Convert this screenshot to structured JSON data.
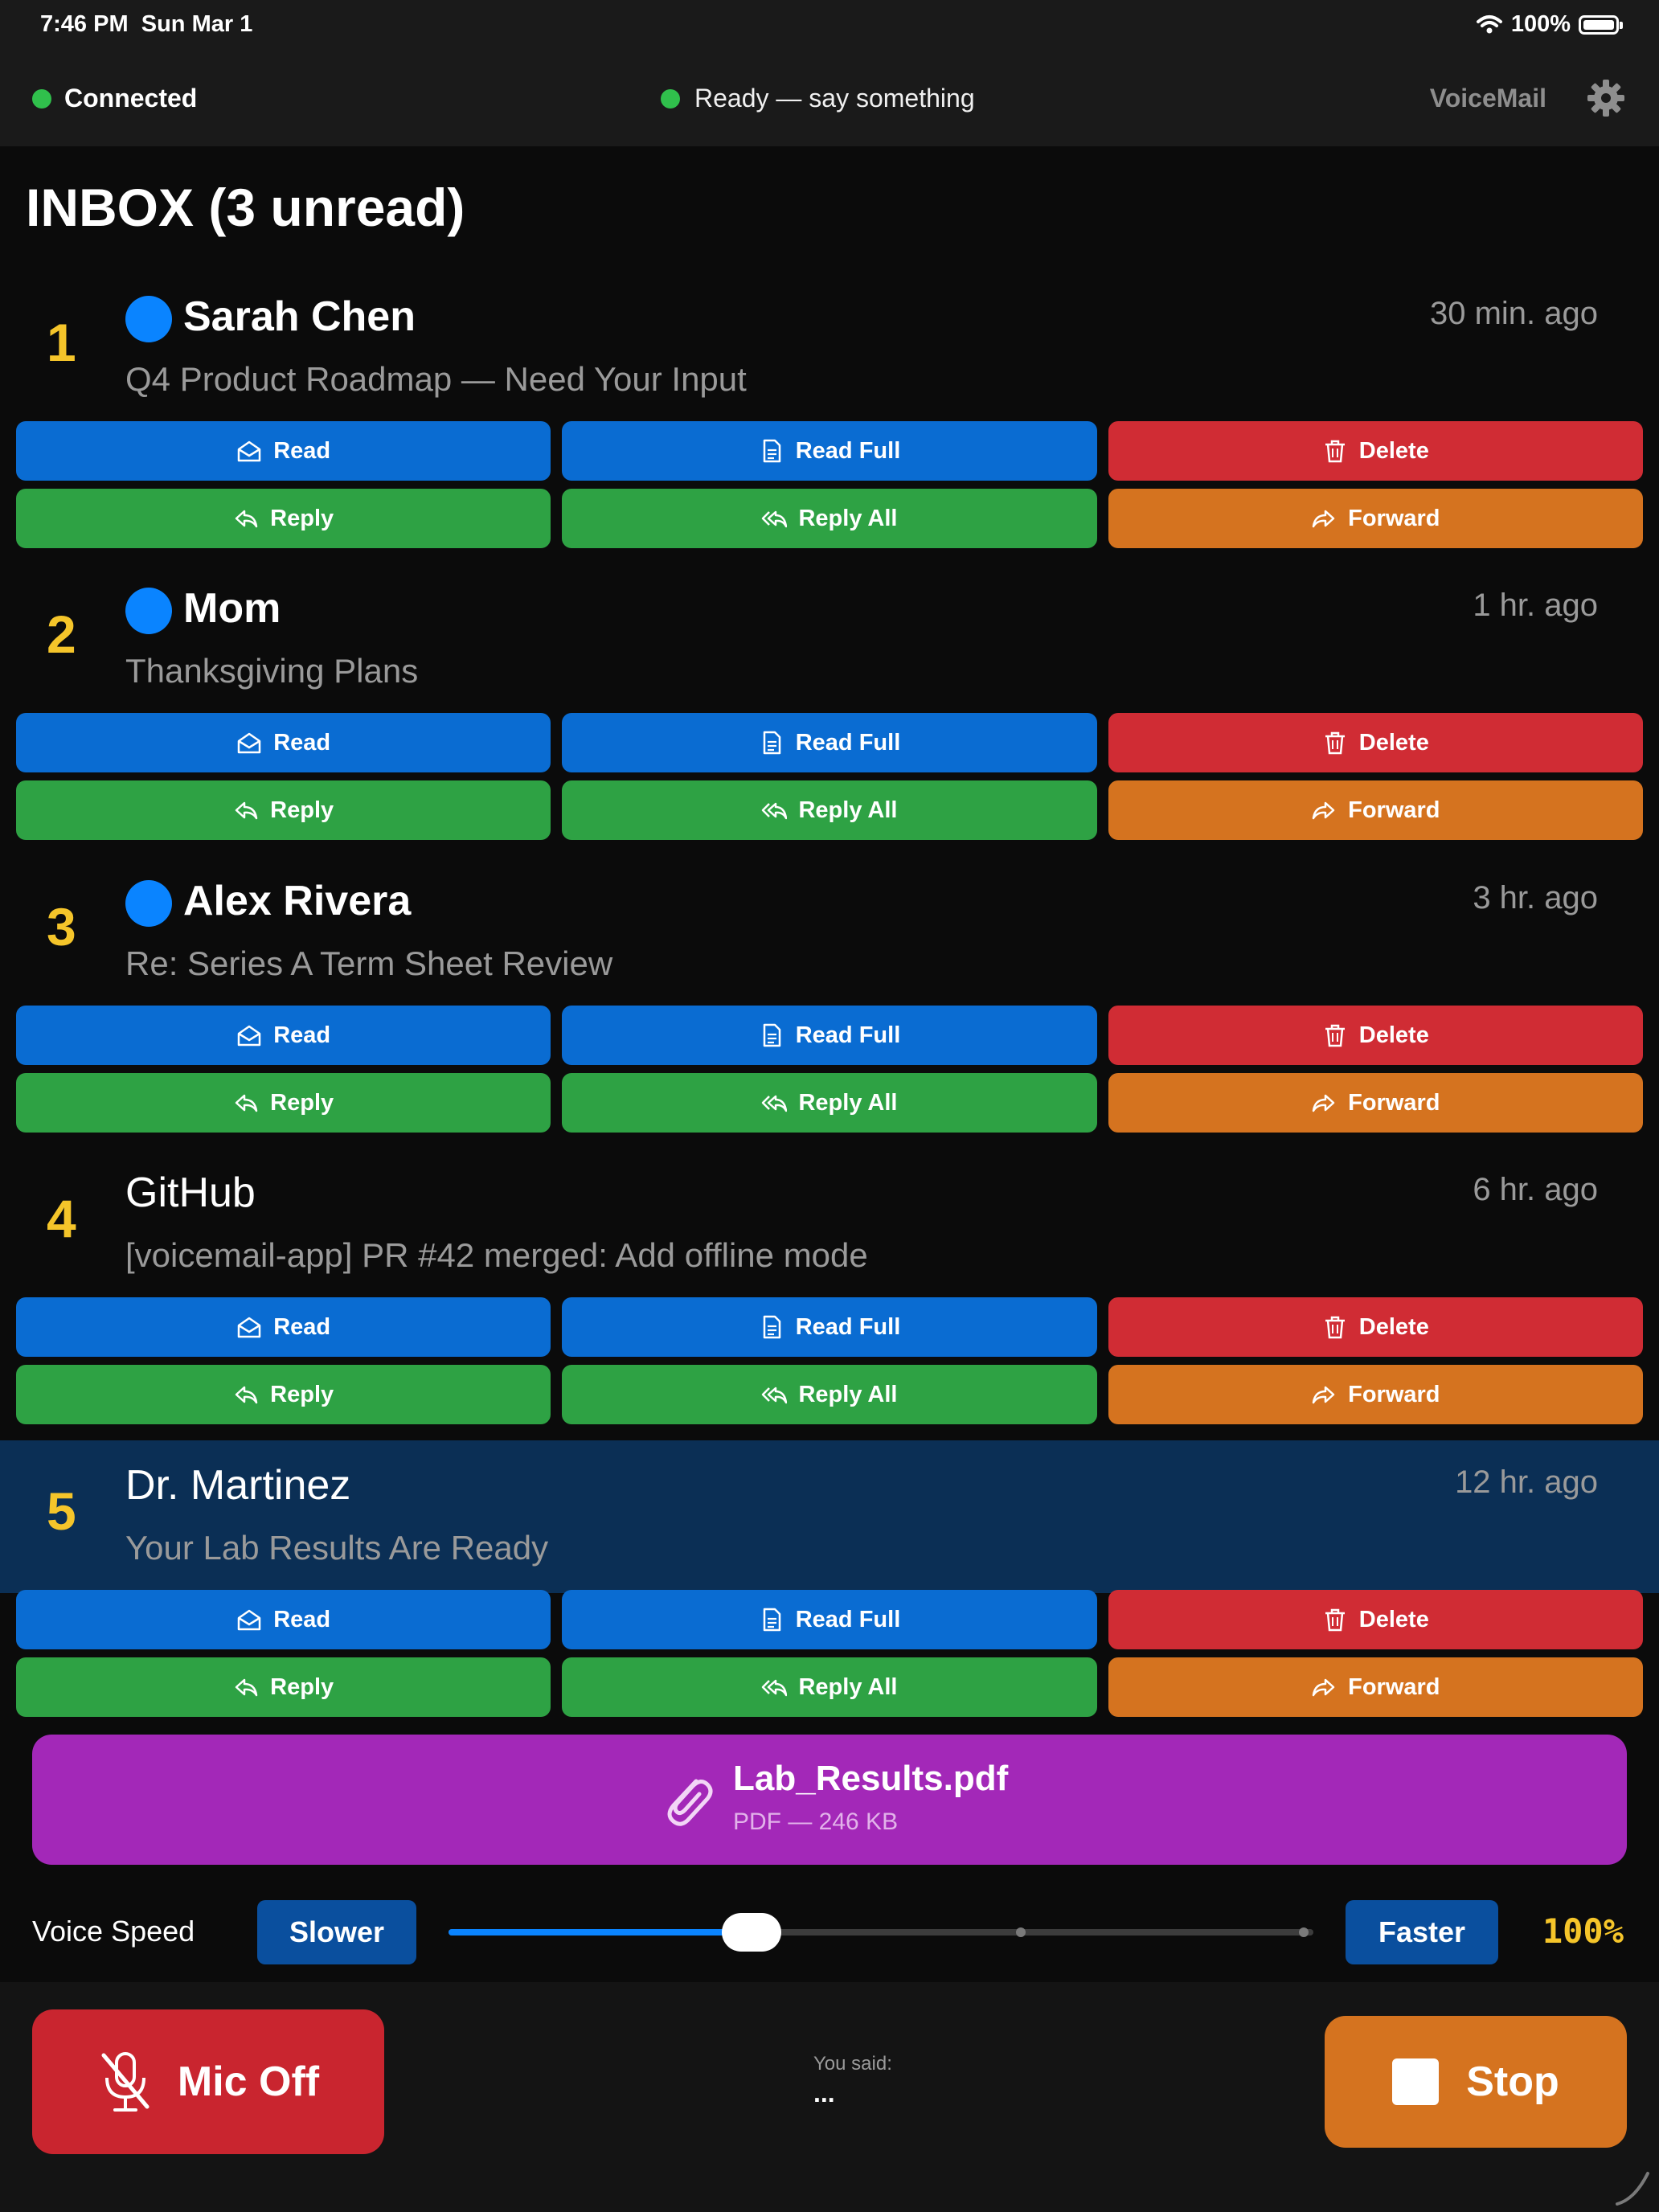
{
  "status_bar": {
    "time": "7:46 PM",
    "date": "Sun Mar 1",
    "battery": "100%",
    "wifi_icon": "wifi-icon",
    "battery_icon": "battery-icon"
  },
  "header": {
    "connection": "Connected",
    "status": "Ready — say something",
    "brand": "VoiceMail",
    "settings_icon": "gear-icon"
  },
  "inbox": {
    "title": "INBOX (3 unread)"
  },
  "actions": {
    "read": "Read",
    "read_full": "Read Full",
    "delete": "Delete",
    "reply": "Reply",
    "reply_all": "Reply All",
    "forward": "Forward"
  },
  "emails": [
    {
      "index": "1",
      "sender": "Sarah Chen",
      "time": "30 min. ago",
      "subject": "Q4 Product Roadmap — Need Your Input",
      "unread": true
    },
    {
      "index": "2",
      "sender": "Mom",
      "time": "1 hr. ago",
      "subject": "Thanksgiving Plans",
      "unread": true
    },
    {
      "index": "3",
      "sender": "Alex Rivera",
      "time": "3 hr. ago",
      "subject": "Re: Series A Term Sheet Review",
      "unread": true
    },
    {
      "index": "4",
      "sender": "GitHub",
      "time": "6 hr. ago",
      "subject": "[voicemail-app] PR #42 merged: Add offline mode",
      "unread": false
    },
    {
      "index": "5",
      "sender": "Dr. Martinez",
      "time": "12 hr. ago",
      "subject": "Your Lab Results Are Ready",
      "unread": false,
      "selected": true
    }
  ],
  "attachment": {
    "name": "Lab_Results.pdf",
    "meta": "PDF — 246 KB",
    "icon": "paperclip-icon"
  },
  "voice_speed": {
    "label": "Voice Speed",
    "slower": "Slower",
    "faster": "Faster",
    "value": "100%",
    "slider_fraction": 0.35
  },
  "bottom": {
    "mic_label": "Mic Off",
    "mic_icon": "mic-off-icon",
    "you_said_label": "You said:",
    "you_said_value": "...",
    "stop_label": "Stop",
    "stop_icon": "stop-icon"
  },
  "colors": {
    "accent_blue": "#0a6cd2",
    "delete_red": "#d02c34",
    "reply_green": "#2ea244",
    "forward_orange": "#d5731f",
    "attachment_purple": "#a328b8",
    "number_yellow": "#f5c52a",
    "selected_row": "#0b2f55"
  }
}
